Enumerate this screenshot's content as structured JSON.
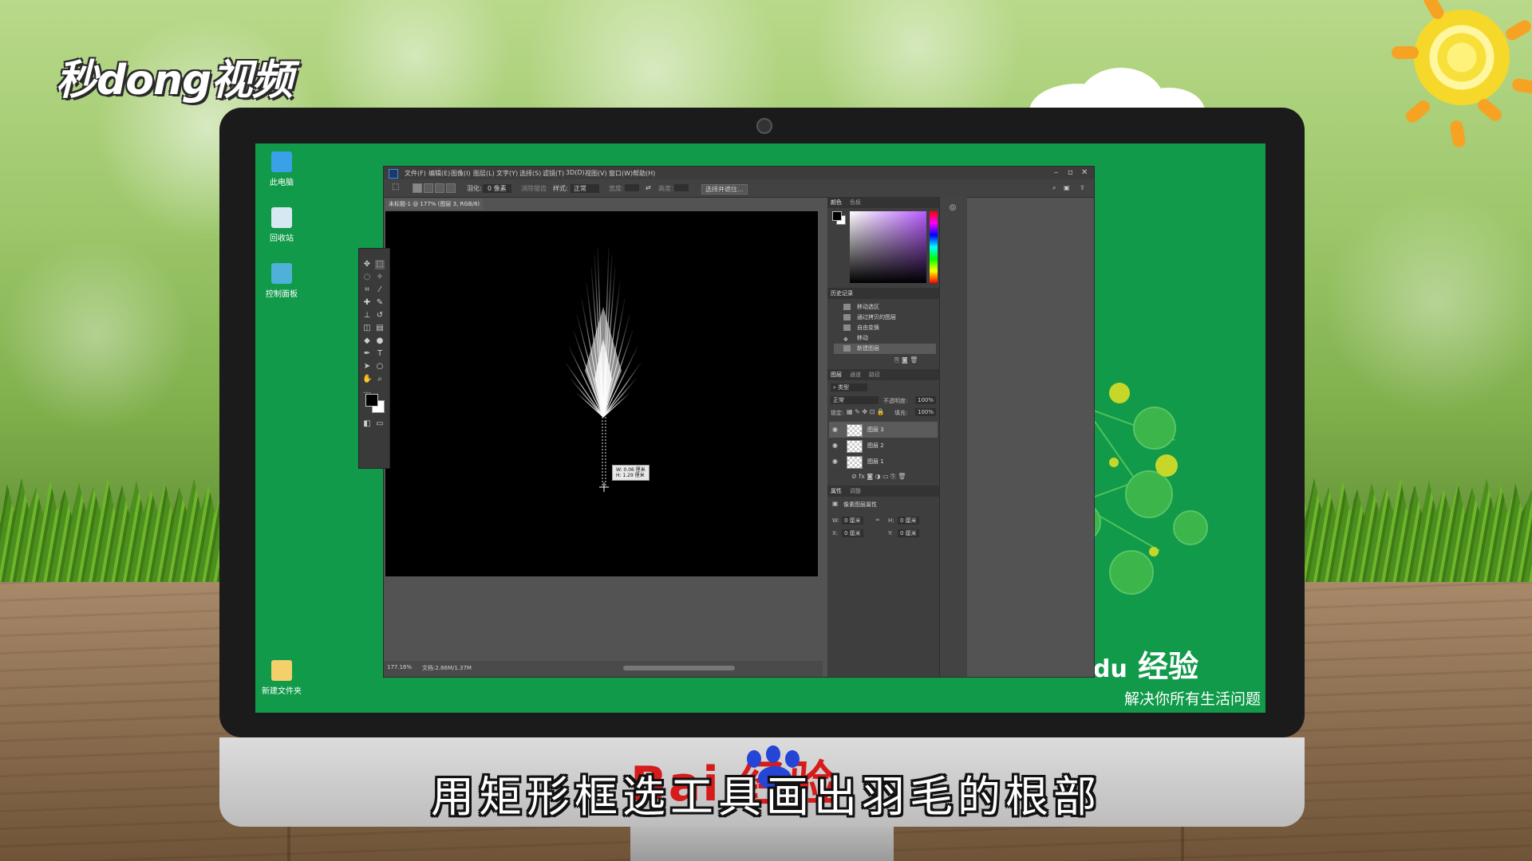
{
  "brand": {
    "video_logo": "秒dong视频"
  },
  "desktop": {
    "icons": [
      {
        "label": "此电脑"
      },
      {
        "label": "回收站"
      },
      {
        "label": "控制面板"
      },
      {
        "label": "新建文件夹"
      }
    ],
    "baidu_experience": "经验",
    "baidu_slogan": "解决你所有生活问题"
  },
  "photoshop": {
    "menu": [
      "文件(F)",
      "编辑(E)",
      "图像(I)",
      "图层(L)",
      "文字(Y)",
      "选择(S)",
      "滤镜(T)",
      "3D(D)",
      "视图(V)",
      "窗口(W)",
      "帮助(H)"
    ],
    "options": {
      "feather_label": "羽化:",
      "feather_value": "0 像素",
      "antialias": "消除锯齿",
      "style_label": "样式:",
      "style_value": "正常",
      "width_label": "宽度:",
      "height_label": "高度:",
      "select_mask": "选择并遮住..."
    },
    "document_tab": "未标题-1 @ 177% (图层 3, RGB/8) *",
    "status": {
      "zoom": "177.16%",
      "doc": "文档:2.86M/1.37M"
    },
    "size_tooltip": {
      "w": "W: 0.06 厘米",
      "h": "H: 1.29 厘米"
    },
    "color_panel": {
      "tab_color": "颜色",
      "tab_swatches": "色板"
    },
    "history_panel": {
      "title": "历史记录",
      "items": [
        "移动选区",
        "通过拷贝的图层",
        "自由变换",
        "移动",
        "新建图层"
      ]
    },
    "layers_panel": {
      "tabs": [
        "图层",
        "通道",
        "路径"
      ],
      "kind_filter": "类型",
      "blend_mode": "正常",
      "opacity_label": "不透明度:",
      "opacity_value": "100%",
      "lock_label": "锁定:",
      "fill_label": "填充:",
      "fill_value": "100%",
      "layers": [
        "图层 3",
        "图层 2",
        "图层 1"
      ]
    },
    "properties_panel": {
      "tabs": [
        "属性",
        "调整"
      ],
      "title": "像素图层属性",
      "w_label": "W:",
      "w_value": "0 厘米",
      "h_label": "H:",
      "h_value": "0 厘米",
      "x_label": "X:",
      "x_value": "0 厘米",
      "y_label": "Y:",
      "y_value": "0 厘米"
    }
  },
  "subtitle": "用矩形框选工具画出羽毛的根部",
  "chin_logo": "Bai 经验",
  "colors": {
    "desktop_green": "#109a4a",
    "ps_dark": "#535353",
    "sun_orange": "#f6a323",
    "baidu_red": "#d61b1b",
    "baidu_blue": "#2545d6"
  }
}
